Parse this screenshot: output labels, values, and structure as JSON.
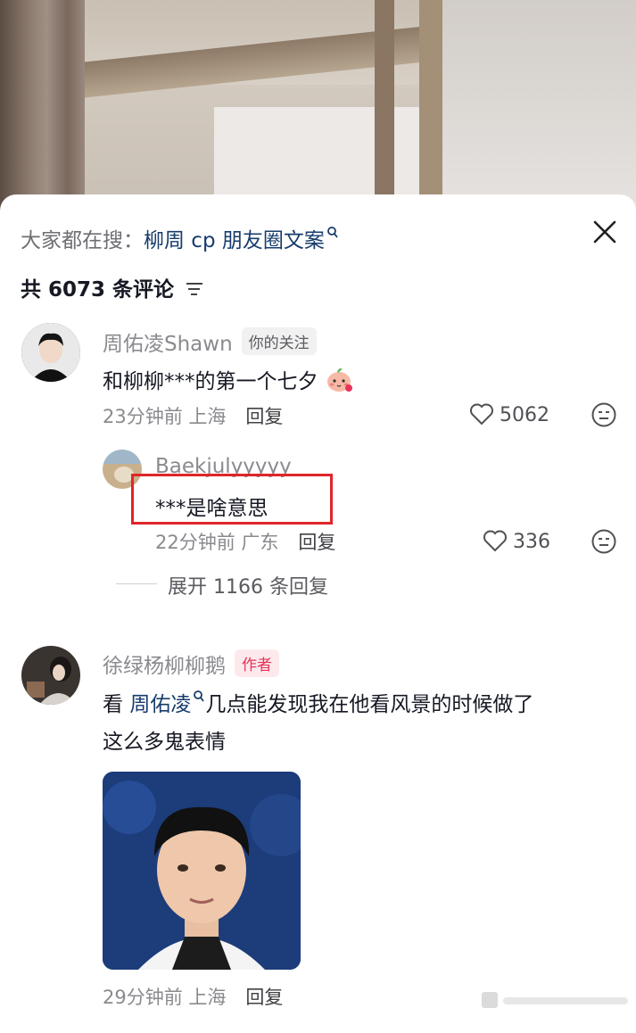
{
  "search": {
    "prefix": "大家都在搜：",
    "term": "柳周 cp 朋友圈文案"
  },
  "comments_count": "共 6073 条评论",
  "comment1": {
    "username": "周佑凌Shawn",
    "tag": "你的关注",
    "text": "和柳柳***的第一个七夕",
    "time_location": "23分钟前 上海",
    "reply_label": "回复",
    "likes": "5062"
  },
  "reply1": {
    "username": "Baekjulyyyyy",
    "text": "***是啥意思",
    "time_location": "22分钟前 广东",
    "reply_label": "回复",
    "likes": "336"
  },
  "expand_label": "展开 1166 条回复",
  "comment2": {
    "username": "徐绿杨柳柳鹅",
    "tag": "作者",
    "text_prefix": "看",
    "mention": "周佑凌",
    "text_line1_rest": "几点能发现我在他看风景的时候做了",
    "text_line2": "这么多鬼表情",
    "time_location": "29分钟前 上海",
    "reply_label": "回复"
  },
  "colors": {
    "accent_link": "#173c6b",
    "author_tag": "#e5345a",
    "highlight_box": "#e0252b"
  }
}
